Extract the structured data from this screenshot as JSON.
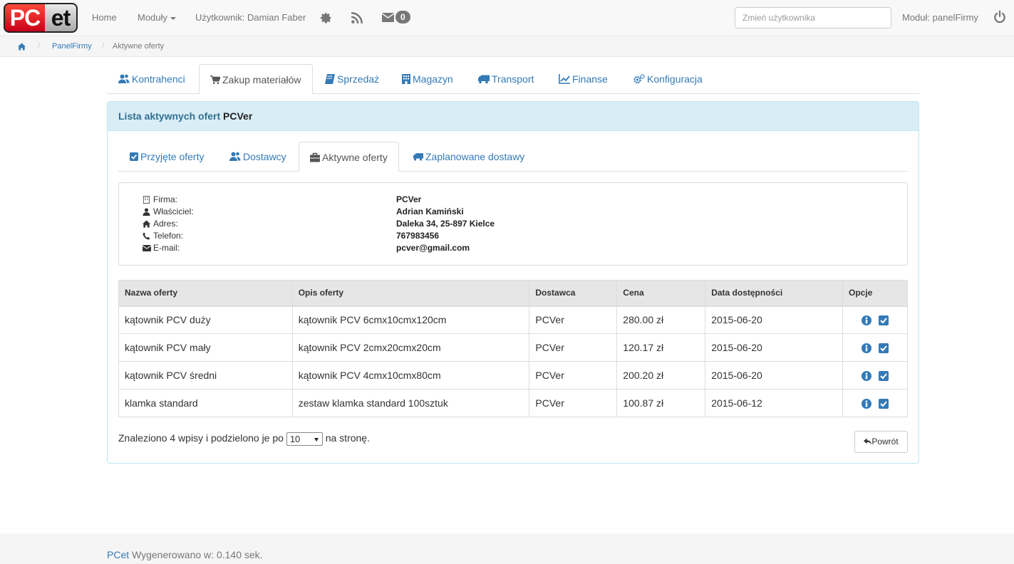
{
  "navbar": {
    "brand_pc": "PC",
    "brand_et": "et",
    "home": "Home",
    "modules": "Moduły",
    "user": "Użytkownik: Damian Faber",
    "messages_count": "0",
    "user_search_placeholder": "Zmień użytkownika",
    "module_label": "Moduł: panelFirmy"
  },
  "breadcrumb": {
    "items": [
      "PanelFirmy",
      "Aktywne oferty"
    ]
  },
  "main_tabs": [
    {
      "label": "Kontrahenci",
      "icon": "users-icon"
    },
    {
      "label": "Zakup materiałów",
      "icon": "cart-icon",
      "active": true
    },
    {
      "label": "Sprzedaż",
      "icon": "book-icon"
    },
    {
      "label": "Magazyn",
      "icon": "building-icon"
    },
    {
      "label": "Transport",
      "icon": "truck-icon"
    },
    {
      "label": "Finanse",
      "icon": "line-chart-icon"
    },
    {
      "label": "Konfiguracja",
      "icon": "cogs-icon"
    }
  ],
  "panel": {
    "title_prefix": "Lista aktywnych ofert",
    "title_company": "PCVer"
  },
  "sub_tabs": [
    {
      "label": "Przyjęte oferty",
      "icon": "check-square-icon"
    },
    {
      "label": "Dostawcy",
      "icon": "users-icon"
    },
    {
      "label": "Aktywne oferty",
      "icon": "briefcase-icon",
      "active": true
    },
    {
      "label": "Zaplanowane dostawy",
      "icon": "truck-icon"
    }
  ],
  "company_info": {
    "firma_label": "Firma:",
    "firma_value": "PCVer",
    "owner_label": "Właściciel:",
    "owner_value": "Adrian Kamiński",
    "address_label": "Adres:",
    "address_value": "Daleka 34, 25-897 Kielce",
    "phone_label": "Telefon:",
    "phone_value": "767983456",
    "email_label": "E-mail:",
    "email_value": "pcver@gmail.com"
  },
  "table": {
    "headers": [
      "Nazwa oferty",
      "Opis oferty",
      "Dostawca",
      "Cena",
      "Data dostępności",
      "Opcje"
    ],
    "rows": [
      [
        "kątownik PCV duży",
        "kątownik PCV 6cmx10cmx120cm",
        "PCVer",
        "280.00 zł",
        "2015-06-20"
      ],
      [
        "kątownik PCV mały",
        "kątownik PCV 2cmx20cmx20cm",
        "PCVer",
        "120.17 zł",
        "2015-06-20"
      ],
      [
        "kątownik PCV średni",
        "kątownik PCV 4cmx10cmx80cm",
        "PCVer",
        "200.20 zł",
        "2015-06-20"
      ],
      [
        "klamka standard",
        "zestaw klamka standard 100sztuk",
        "PCVer",
        "100.87 zł",
        "2015-06-12"
      ]
    ]
  },
  "pagination": {
    "prefix": "Znaleziono 4 wpisy i podzielono je po",
    "per_page": "10",
    "suffix": "na stronę."
  },
  "back_button": "Powrót",
  "footer": {
    "brand": "PCet",
    "text": "Wygenerowano w: 0.140 sek."
  },
  "colors": {
    "link": "#337ab7",
    "panel_heading_bg": "#d9edf7",
    "panel_border": "#bce8f1"
  }
}
